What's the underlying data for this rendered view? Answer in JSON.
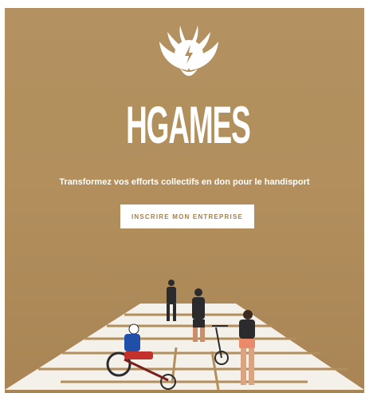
{
  "brand": {
    "wordmark": "HGAMES"
  },
  "hero": {
    "tagline": "Transformez vos efforts collectifs en don pour le handisport",
    "cta_label": "INSCRIRE MON ENTREPRISE",
    "background_color": "#b28f5d",
    "accent_color": "#a67e45"
  },
  "icons": [
    "phoenix-logo-icon",
    "lightning-bolt-icon"
  ]
}
